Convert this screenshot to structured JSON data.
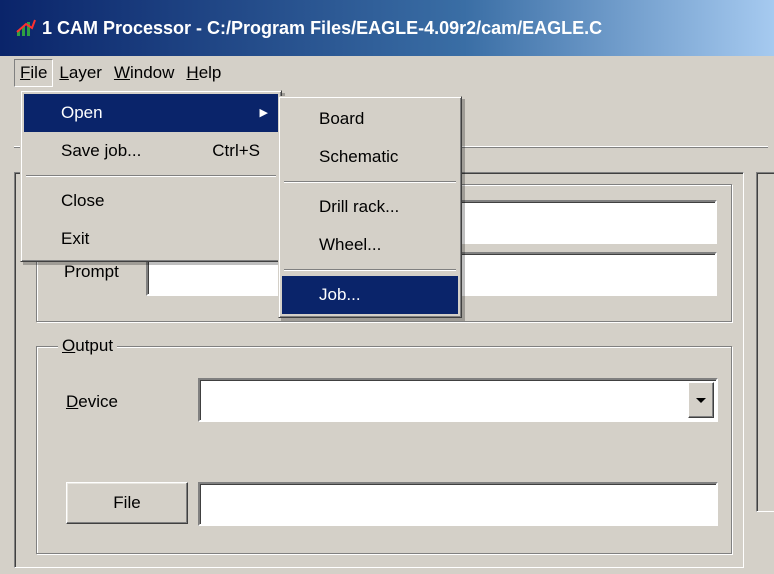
{
  "window": {
    "title": "1 CAM Processor - C:/Program Files/EAGLE-4.09r2/cam/EAGLE.C",
    "icon": "eagle-app-icon"
  },
  "menubar": {
    "items": [
      {
        "label": "File",
        "active": true
      },
      {
        "label": "Layer"
      },
      {
        "label": "Window"
      },
      {
        "label": "Help"
      }
    ]
  },
  "file_menu": {
    "items": [
      {
        "label": "Open",
        "submenu": true,
        "highlighted": true
      },
      {
        "label": "Save job...",
        "shortcut": "Ctrl+S"
      },
      {
        "label": "Close"
      },
      {
        "label": "Exit"
      }
    ]
  },
  "open_submenu": {
    "items": [
      {
        "label": "Board"
      },
      {
        "label": "Schematic"
      },
      {
        "label": "Drill rack..."
      },
      {
        "label": "Wheel..."
      },
      {
        "label": "Job...",
        "highlighted": true
      }
    ]
  },
  "job_section": {
    "prompt_label": "Prompt",
    "name_value": "",
    "prompt_value": ""
  },
  "output_section": {
    "title": "Output",
    "device_label": "Device",
    "device_value": "",
    "file_button_label": "File",
    "file_value": ""
  },
  "colors": {
    "face": "#d4d0c8",
    "highlight": "#0a246a",
    "title_start": "#0a246a",
    "title_end": "#a6caf0"
  }
}
